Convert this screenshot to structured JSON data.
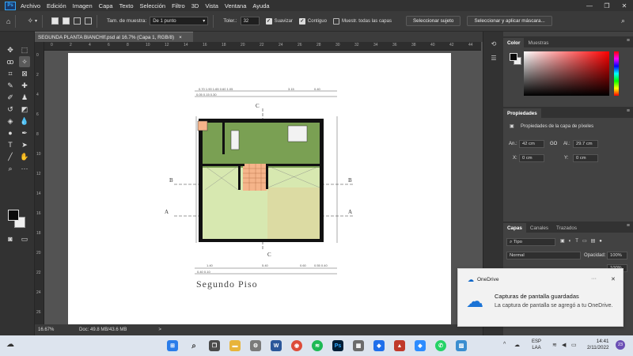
{
  "menu": {
    "items": [
      "Archivo",
      "Edición",
      "Imagen",
      "Capa",
      "Texto",
      "Selección",
      "Filtro",
      "3D",
      "Vista",
      "Ventana",
      "Ayuda"
    ],
    "logo": "Ps"
  },
  "options": {
    "sample_size_label": "Tam. de muestra:",
    "sample_size_value": "De 1 punto",
    "tolerance_label": "Toler.:",
    "tolerance_value": "32",
    "smooth_label": "Suavizar",
    "contiguous_label": "Contiguo",
    "sample_all_label": "Muestr. todas las capas",
    "select_subject_button": "Seleccionar sujeto",
    "select_mask_button": "Seleccionar y aplicar máscara..."
  },
  "document": {
    "tab_title": "SEGUNDA PLANTA BIANCHIf.psd al 16.7% (Capa 1, RGB/8)",
    "tab_close": "×",
    "drawing_title": "Segundo Piso",
    "section_labels": [
      "A",
      "A",
      "B",
      "B",
      "C",
      "C"
    ]
  },
  "ruler": {
    "h_ticks": [
      "0",
      "2",
      "4",
      "6",
      "8",
      "10",
      "12",
      "14",
      "16",
      "18",
      "20",
      "22",
      "24",
      "26",
      "28",
      "30",
      "32",
      "34",
      "36",
      "38",
      "40",
      "42",
      "44"
    ],
    "v_ticks": [
      "0",
      "2",
      "4",
      "6",
      "8",
      "10",
      "12",
      "14",
      "16",
      "18",
      "20",
      "22",
      "24",
      "26"
    ]
  },
  "status": {
    "zoom": "16.67%",
    "doc_info": "Doc: 49.8 MB/43.6 MB",
    "arrow": ">"
  },
  "color_panel": {
    "tabs": [
      "Color",
      "Muestras"
    ]
  },
  "properties_panel": {
    "title": "Propiedades",
    "subtitle": "Propiedades de la capa de píxeles",
    "width_label": "An.:",
    "width_value": "42 cm",
    "height_label": "Al.:",
    "height_value": "29.7 cm",
    "x_label": "X:",
    "x_value": "0 cm",
    "y_label": "Y:",
    "y_value": "0 cm",
    "link_label": "GO"
  },
  "layers_panel": {
    "tabs": [
      "Capas",
      "Canales",
      "Trazados"
    ],
    "kind_filter": "Tipo",
    "blend_mode": "Normal",
    "opacity_label": "Opacidad:",
    "opacity_value": "100%",
    "fill_value": "100%"
  },
  "toast": {
    "app_name": "OneDrive",
    "dots": "···",
    "close": "✕",
    "title": "Capturas de pantalla guardadas",
    "body": "La captura de pantalla se agregó a tu OneDrive."
  },
  "taskbar": {
    "lang_line1": "ESP",
    "lang_line2": "LAA",
    "time": "14:41",
    "date": "2/11/2022",
    "badge": "23"
  },
  "colors": {
    "accent": "#31a8ff",
    "floor_green": "#7aa053",
    "floor_light": "#d7e8b0",
    "floor_beige": "#dcdba3",
    "stairs": "#f5b48a"
  }
}
